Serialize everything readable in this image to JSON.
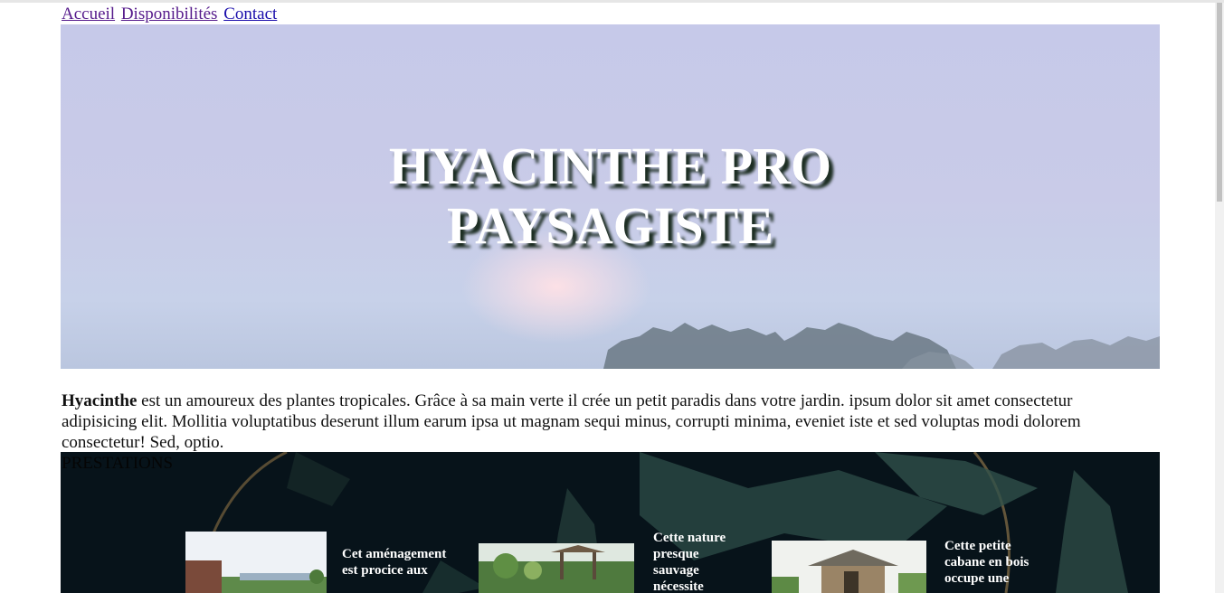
{
  "nav": {
    "links": [
      {
        "label": "Accueil"
      },
      {
        "label": "Disponibilités"
      },
      {
        "label": "Contact"
      }
    ]
  },
  "hero": {
    "title_line1": "HYACINTHE PRO",
    "title_line2": "PAYSAGISTE"
  },
  "intro": {
    "name": "Hyacinthe",
    "text": " est un amoureux des plantes tropicales. Grâce à sa main verte il crée un petit paradis dans votre jardin. ipsum dolor sit amet consectetur adipisicing elit. Mollitia voluptatibus deserunt illum earum ipsa ut magnam sequi minus, corrupti minima, eveniet iste et sed voluptas modi dolorem consectetur! Sed, optio."
  },
  "services": {
    "heading": "PRESTATIONS",
    "cards": [
      {
        "text": "Cet aménagement est procice aux"
      },
      {
        "text": "Cette nature presque sauvage nécessite"
      },
      {
        "text": "Cette petite cabane en bois occupe une"
      }
    ]
  },
  "colors": {
    "link": "#1a0dab",
    "visited_link": "#551a8b",
    "services_bg": "#07131a",
    "hero_title_shadow": "#1c2d22"
  }
}
